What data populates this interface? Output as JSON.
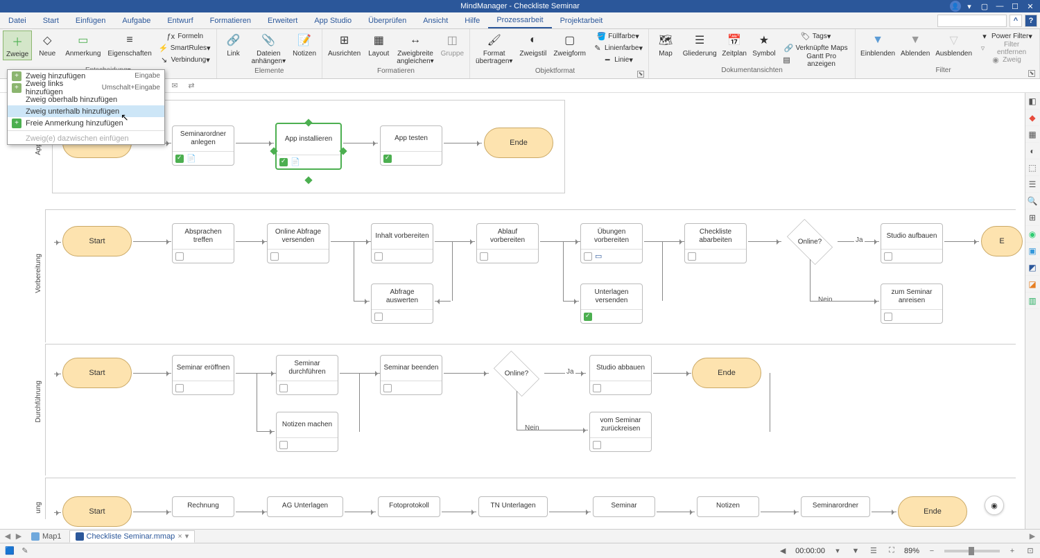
{
  "title": "MindManager - Checkliste Seminar",
  "menu": {
    "tabs": [
      "Datei",
      "Start",
      "Einfügen",
      "Aufgabe",
      "Entwurf",
      "Formatieren",
      "Erweitert",
      "App Studio",
      "Überprüfen",
      "Ansicht",
      "Hilfe",
      "Prozessarbeit",
      "Projektarbeit"
    ],
    "active_index": 11
  },
  "ribbon": {
    "zweige": {
      "label": "Zweige",
      "sublabel": "Entscheidung"
    },
    "neue": "Neue",
    "anmerkung": "Anmerkung",
    "eigenschaften": "Eigenschaften",
    "formeln": "Formeln",
    "smartrules": "SmartRules",
    "verbindung": "Verbindung",
    "link": "Link",
    "dateien_l1": "Dateien",
    "dateien_l2": "anhängen",
    "notizen": "Notizen",
    "group_elemente": "Elemente",
    "ausrichten": "Ausrichten",
    "layout": "Layout",
    "zweigbreite_l1": "Zweigbreite",
    "zweigbreite_l2": "angleichen",
    "gruppe": "Gruppe",
    "group_formatieren": "Formatieren",
    "format_l1": "Format",
    "format_l2": "übertragen",
    "zweigstil": "Zweigstil",
    "zweigform": "Zweigform",
    "fuellfarbe": "Füllfarbe",
    "linienfarbe": "Linienfarbe",
    "linie": "Linie",
    "group_objektformat": "Objektformat",
    "map": "Map",
    "gliederung": "Gliederung",
    "zeitplan": "Zeitplan",
    "symbol": "Symbol",
    "tags": "Tags",
    "verknuepfte": "Verknüpfte Maps",
    "gantt": "Gantt Pro anzeigen",
    "group_dokument": "Dokumentansichten",
    "einblenden": "Einblenden",
    "ablenden": "Ablenden",
    "ausblenden": "Ausblenden",
    "powerfilter": "Power Filter",
    "filter_entfernen": "Filter entfernen",
    "zweig_filter": "Zweig",
    "group_filter": "Filter"
  },
  "dropdown": {
    "items": [
      {
        "icon": "+",
        "label": "Zweig hinzufügen",
        "shortcut": "Eingabe",
        "color": "#8bb56f"
      },
      {
        "icon": "+",
        "label": "Zweig links hinzufügen",
        "shortcut": "Umschalt+Eingabe",
        "color": "#8bb56f"
      },
      {
        "icon": "",
        "label": "Zweig oberhalb hinzufügen",
        "shortcut": "",
        "color": ""
      },
      {
        "icon": "",
        "label": "Zweig unterhalb hinzufügen",
        "shortcut": "",
        "color": "",
        "hover": true
      },
      {
        "icon": "+",
        "label": "Freie Anmerkung hinzufügen",
        "shortcut": "",
        "color": "#4CAF50"
      }
    ],
    "disabled_label": "Zweig(e) dazwischen einfügen"
  },
  "lanes": {
    "app": "App",
    "vorbereitung": "Vorbereitung",
    "durchfuehrung": "Durchführung",
    "nach": "ung"
  },
  "nodes": {
    "start": "Start",
    "ende": "Ende",
    "seminarordner": "Seminarordner anlegen",
    "app_install": "App installieren",
    "app_testen": "App testen",
    "absprachen": "Absprachen treffen",
    "online_abfrage": "Online Abfrage versenden",
    "inhalt": "Inhalt vorbereiten",
    "abfrage_aus": "Abfrage auswerten",
    "ablauf": "Ablauf vorbereiten",
    "uebungen": "Übungen vorbereiten",
    "unterlagen_v": "Unterlagen versenden",
    "checkliste": "Checkliste abarbeiten",
    "online_q": "Online?",
    "ja": "Ja",
    "nein": "Nein",
    "studio_auf": "Studio aufbauen",
    "zum_seminar": "zum Seminar anreisen",
    "seminar_er": "Seminar eröffnen",
    "seminar_du": "Seminar durchführen",
    "notizen_m": "Notizen machen",
    "seminar_be": "Seminar beenden",
    "studio_ab": "Studio abbauen",
    "vom_seminar": "vom Seminar zurückreisen",
    "rechnung": "Rechnung",
    "ag_unterlagen": "AG Unterlagen",
    "fotoprotokoll": "Fotoprotokoll",
    "tn_unterlagen": "TN Unterlagen",
    "seminar_n": "Seminar",
    "notizen_n": "Notizen",
    "seminarordner_n": "Seminarordner"
  },
  "doc_tabs": {
    "map1": "Map1",
    "active": "Checkliste Seminar.mmap"
  },
  "statusbar": {
    "timer": "00:00:00",
    "zoom": "89%"
  },
  "marker_icon": "◉"
}
